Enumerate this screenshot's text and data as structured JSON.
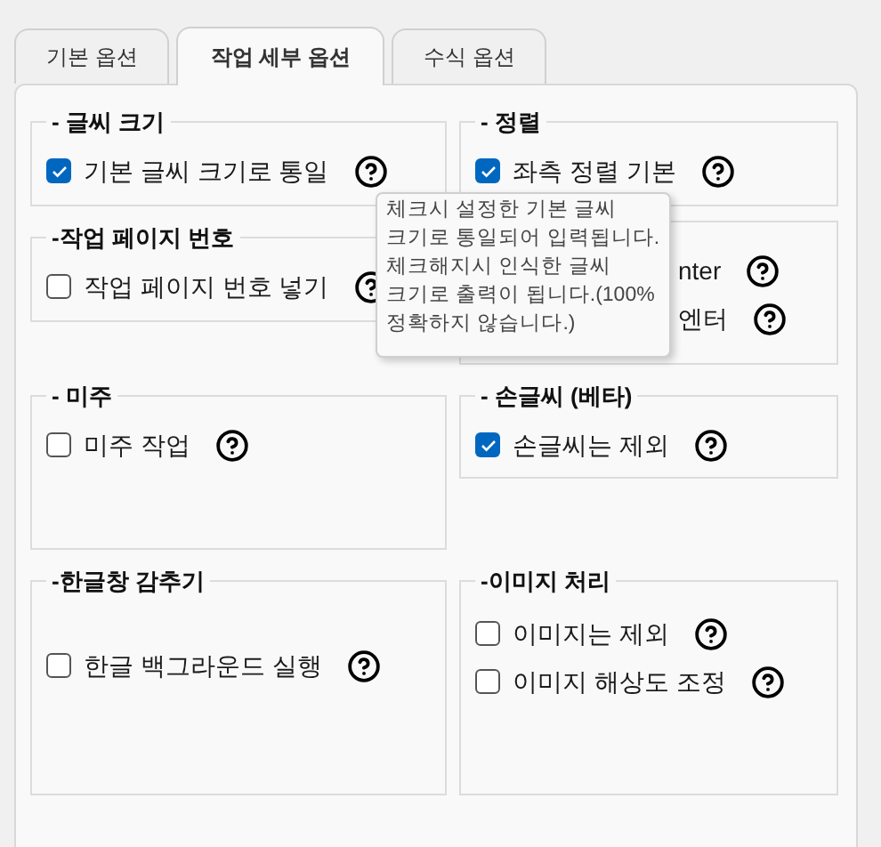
{
  "tabs": [
    {
      "label": "기본 옵션",
      "selected": false
    },
    {
      "label": "작업 세부 옵션",
      "selected": true
    },
    {
      "label": "수식 옵션",
      "selected": false
    }
  ],
  "groups": [
    {
      "legend": "- 글씨 크기",
      "items": [
        {
          "label": "기본 글씨 크기로 통일",
          "checked": true
        }
      ]
    },
    {
      "legend": "- 정렬",
      "items": [
        {
          "label": "좌측 정렬 기본",
          "checked": true
        }
      ]
    },
    {
      "legend": "-작업 페이지 번호",
      "items": [
        {
          "label": "작업 페이지 번호 넣기",
          "checked": false
        }
      ]
    },
    {
      "items": [
        {
          "label": "nter"
        },
        {
          "label": "엔터"
        }
      ]
    },
    {
      "legend": "- 미주",
      "items": [
        {
          "label": "미주 작업",
          "checked": false
        }
      ]
    },
    {
      "legend": "- 손글씨 (베타)",
      "items": [
        {
          "label": "손글씨는 제외",
          "checked": true
        }
      ]
    },
    {
      "legend": "-한글창 감추기",
      "items": [
        {
          "label": "한글 백그라운드 실행",
          "checked": false
        }
      ]
    },
    {
      "legend": "-이미지 처리",
      "items": [
        {
          "label": "이미지는 제외",
          "checked": false
        },
        {
          "label": "이미지 해상도 조정",
          "checked": false
        }
      ]
    }
  ],
  "tooltip": {
    "lines": [
      "체크시 설정한 기본 글씨",
      "크기로 통일되어 입력됩니다.",
      "체크해지시 인식한 글씨",
      "크기로 출력이 됩니다.(100%",
      "정확하지 않습니다.)"
    ]
  }
}
